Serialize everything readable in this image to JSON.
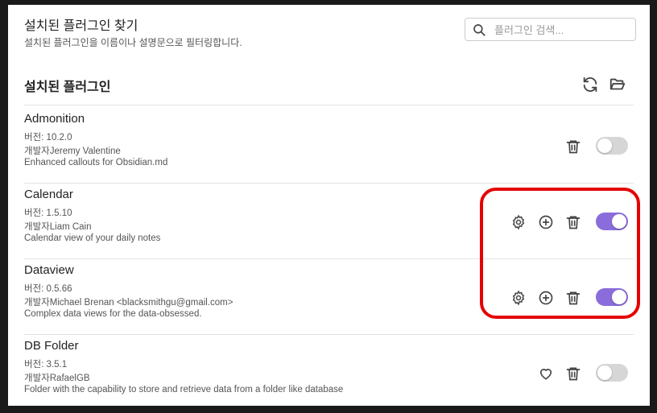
{
  "search": {
    "title": "설치된 플러그인 찾기",
    "description": "설치된 플러그인을 이름이나 설명문으로 필터링합니다.",
    "placeholder": "플러그인 검색..."
  },
  "installed": {
    "title": "설치된 플러그인"
  },
  "plugins": [
    {
      "name": "Admonition",
      "version": "버전: 10.2.0",
      "author": "개발자Jeremy Valentine",
      "description": "Enhanced callouts for Obsidian.md",
      "enabled": false
    },
    {
      "name": "Calendar",
      "version": "버전: 1.5.10",
      "author": "개발자Liam Cain",
      "description": "Calendar view of your daily notes",
      "enabled": true
    },
    {
      "name": "Dataview",
      "version": "버전: 0.5.66",
      "author": "개발자Michael Brenan <blacksmithgu@gmail.com>",
      "description": "Complex data views for the data-obsessed.",
      "enabled": true
    },
    {
      "name": "DB Folder",
      "version": "버전: 3.5.1",
      "author": "개발자RafaelGB",
      "description": "Folder with the capability to store and retrieve data from a folder like database",
      "enabled": false
    }
  ],
  "colors": {
    "toggle_on": "#8a6cdb",
    "toggle_off": "#d6d6d6",
    "highlight": "#e60000"
  }
}
